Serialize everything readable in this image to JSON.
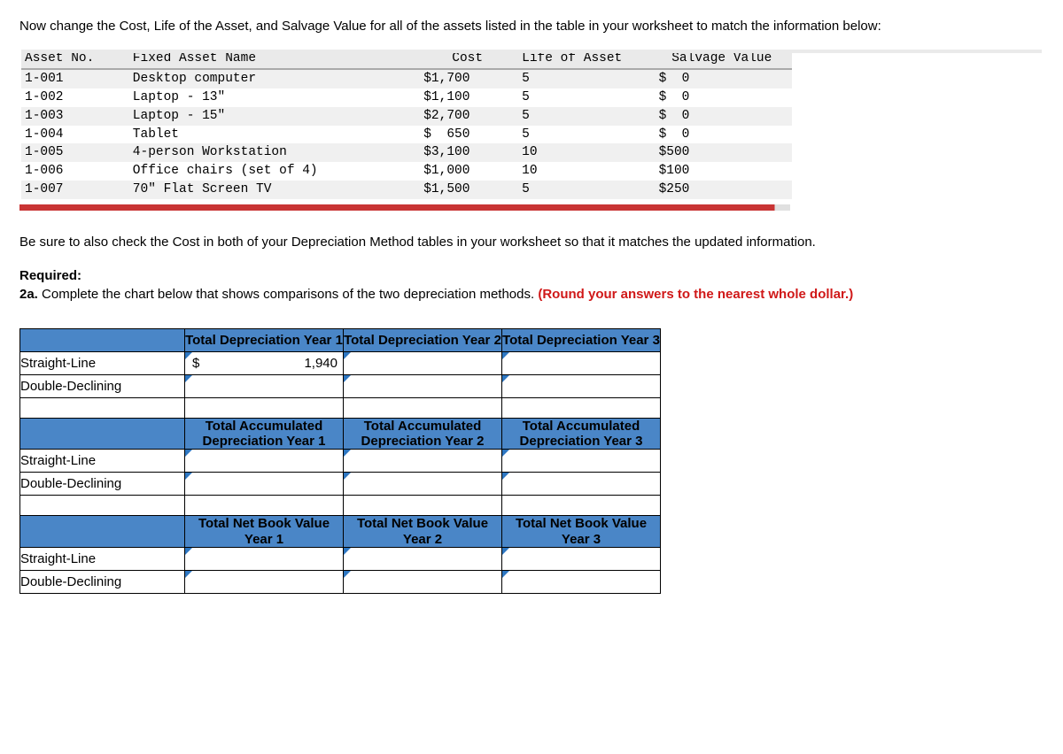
{
  "intro": "Now change the Cost, Life of the Asset, and Salvage Value for all of the assets listed in the table in your worksheet to match the information below:",
  "asset_headers": {
    "no": "Asset No.",
    "name": "Fixed Asset Name",
    "cost": "Cost",
    "life": "Life of Asset",
    "salvage": "Salvage Value"
  },
  "assets": [
    {
      "no": "1-001",
      "name": "Desktop computer",
      "cost": "$1,700",
      "life": "5",
      "salvage": "$  0"
    },
    {
      "no": "1-002",
      "name": "Laptop - 13\"",
      "cost": "$1,100",
      "life": "5",
      "salvage": "$  0"
    },
    {
      "no": "1-003",
      "name": "Laptop - 15\"",
      "cost": "$2,700",
      "life": "5",
      "salvage": "$  0"
    },
    {
      "no": "1-004",
      "name": "Tablet",
      "cost": "$  650",
      "life": "5",
      "salvage": "$  0"
    },
    {
      "no": "1-005",
      "name": "4-person Workstation",
      "cost": "$3,100",
      "life": "10",
      "salvage": "$500"
    },
    {
      "no": "1-006",
      "name": "Office chairs (set of 4)",
      "cost": "$1,000",
      "life": "10",
      "salvage": "$100"
    },
    {
      "no": "1-007",
      "name": "70\" Flat Screen TV",
      "cost": "$1,500",
      "life": "5",
      "salvage": "$250"
    }
  ],
  "note": "Be sure to also check the Cost in both of your Depreciation Method tables in your worksheet so that it matches the updated information.",
  "required_label": "Required:",
  "required_text_prefix": "2a.",
  "required_text": " Complete the chart below that shows comparisons of the two depreciation methods. ",
  "required_red": "(Round your answers to the nearest whole dollar.)",
  "chart_data": {
    "type": "table",
    "sections": [
      {
        "headers": [
          "Total Depreciation Year 1",
          "Total Depreciation Year 2",
          "Total Depreciation Year 3"
        ],
        "rows": [
          {
            "label": "Straight-Line",
            "values": [
              "$ 1,940",
              "",
              ""
            ]
          },
          {
            "label": "Double-Declining",
            "values": [
              "",
              "",
              ""
            ]
          }
        ]
      },
      {
        "headers": [
          "Total Accumulated Depreciation Year 1",
          "Total Accumulated Depreciation Year 2",
          "Total Accumulated Depreciation Year 3"
        ],
        "rows": [
          {
            "label": "Straight-Line",
            "values": [
              "",
              "",
              ""
            ]
          },
          {
            "label": "Double-Declining",
            "values": [
              "",
              "",
              ""
            ]
          }
        ]
      },
      {
        "headers": [
          "Total Net Book Value Year 1",
          "Total Net Book Value Year 2",
          "Total Net Book Value Year 3"
        ],
        "rows": [
          {
            "label": "Straight-Line",
            "values": [
              "",
              "",
              ""
            ]
          },
          {
            "label": "Double-Declining",
            "values": [
              "",
              "",
              ""
            ]
          }
        ]
      }
    ]
  },
  "currency_symbol": "$",
  "filled_value": "1,940"
}
